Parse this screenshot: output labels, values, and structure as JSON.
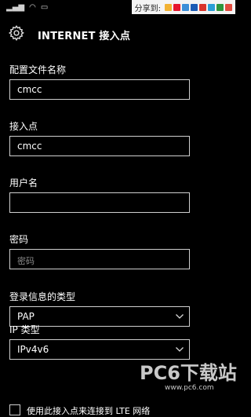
{
  "status_bar": {
    "share_label": "分享到:",
    "share_icons": [
      {
        "name": "qzone-share-icon",
        "color": "#f2b233"
      },
      {
        "name": "weibo-share-icon",
        "color": "#e6162d"
      },
      {
        "name": "tencent-weibo-share-icon",
        "color": "#3b8ed8"
      },
      {
        "name": "renren-share-icon",
        "color": "#1a5bb5"
      },
      {
        "name": "kaixin-share-icon",
        "color": "#d9342b"
      },
      {
        "name": "qq-share-icon",
        "color": "#2a9fd6"
      },
      {
        "name": "douban-share-icon",
        "color": "#2e963d"
      },
      {
        "name": "more-share-icon",
        "color": "#e24c3f"
      }
    ]
  },
  "header": {
    "title": "INTERNET 接入点"
  },
  "form": {
    "profile_name": {
      "label": "配置文件名称",
      "value": "cmcc"
    },
    "apn": {
      "label": "接入点",
      "value": "cmcc"
    },
    "username": {
      "label": "用户名",
      "value": ""
    },
    "password": {
      "label": "密码",
      "placeholder": "密码"
    },
    "auth_type": {
      "label": "登录信息的类型",
      "selected": "PAP"
    },
    "ip_type": {
      "label": "IP 类型",
      "selected": "IPv4v6"
    },
    "lte_checkbox": {
      "label": "使用此接入点来连接到 LTE 网络",
      "checked": false
    }
  },
  "watermark": {
    "title": "PC6下载站",
    "url": "www.pc6.com"
  }
}
